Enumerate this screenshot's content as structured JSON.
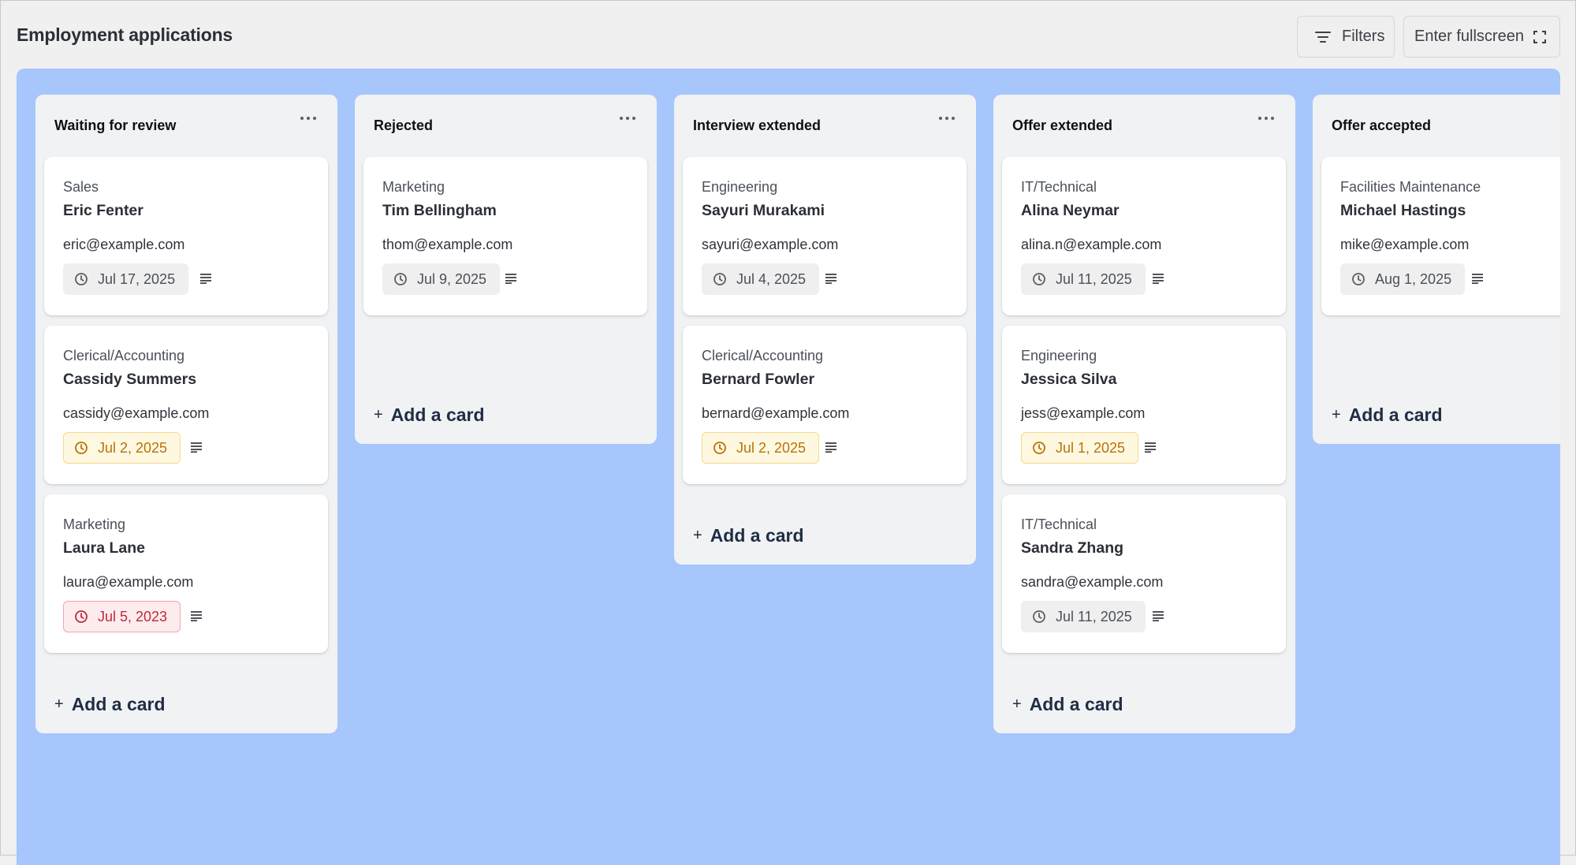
{
  "page": {
    "title": "Employment applications",
    "filters_label": "Filters",
    "fullscreen_label": "Enter fullscreen"
  },
  "colors": {
    "board_bg": "#a6c6fc",
    "column_bg": "#f1f2f4",
    "warn_badge": "#fff8e0",
    "overdue_badge": "#fdecee"
  },
  "icons": {
    "filters": "filter-lines-icon",
    "fullscreen": "expand-corners-icon",
    "column_menu": "more-horizontal-icon",
    "due_date": "clock-icon",
    "description": "text-lines-icon",
    "add": "plus-icon"
  },
  "add_card_label": "Add a card",
  "columns": [
    {
      "title": "Waiting for review",
      "cards": [
        {
          "dept": "Sales",
          "name": "Eric Fenter",
          "email": "eric@example.com",
          "date": "Jul 17, 2025",
          "status": "normal"
        },
        {
          "dept": "Clerical/Accounting",
          "name": "Cassidy Summers",
          "email": "cassidy@example.com",
          "date": "Jul 2, 2025",
          "status": "warn"
        },
        {
          "dept": "Marketing",
          "name": "Laura Lane",
          "email": "laura@example.com",
          "date": "Jul 5, 2023",
          "status": "overdue"
        }
      ]
    },
    {
      "title": "Rejected",
      "cards": [
        {
          "dept": "Marketing",
          "name": "Tim Bellingham",
          "email": "thom@example.com",
          "date": "Jul 9, 2025",
          "status": "normal"
        }
      ]
    },
    {
      "title": "Interview extended",
      "cards": [
        {
          "dept": "Engineering",
          "name": "Sayuri Murakami",
          "email": "sayuri@example.com",
          "date": "Jul 4, 2025",
          "status": "normal"
        },
        {
          "dept": "Clerical/Accounting",
          "name": "Bernard Fowler",
          "email": "bernard@example.com",
          "date": "Jul 2, 2025",
          "status": "warn"
        }
      ]
    },
    {
      "title": "Offer extended",
      "cards": [
        {
          "dept": "IT/Technical",
          "name": "Alina Neymar",
          "email": "alina.n@example.com",
          "date": "Jul 11, 2025",
          "status": "normal"
        },
        {
          "dept": "Engineering",
          "name": "Jessica Silva",
          "email": "jess@example.com",
          "date": "Jul 1, 2025",
          "status": "warn"
        },
        {
          "dept": "IT/Technical",
          "name": "Sandra Zhang",
          "email": "sandra@example.com",
          "date": "Jul 11, 2025",
          "status": "normal"
        }
      ]
    },
    {
      "title": "Offer accepted",
      "cards": [
        {
          "dept": "Facilities Maintenance",
          "name": "Michael Hastings",
          "email": "mike@example.com",
          "date": "Aug 1, 2025",
          "status": "normal"
        }
      ]
    }
  ]
}
